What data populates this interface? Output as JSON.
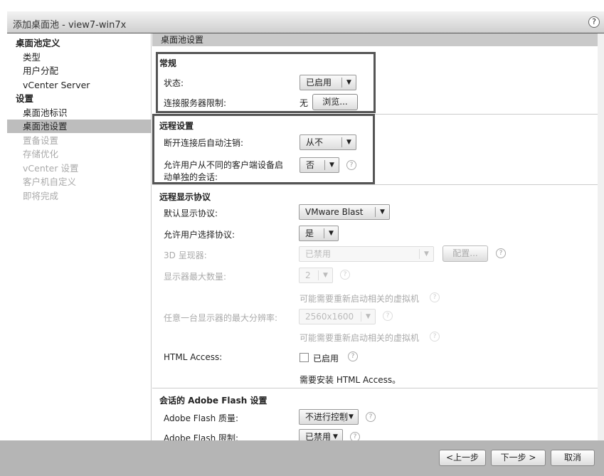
{
  "window": {
    "title": "添加桌面池 - view7-win7x",
    "help": "?"
  },
  "sidebar": {
    "items": [
      {
        "label": "桌面池定义",
        "kind": "h"
      },
      {
        "label": "类型",
        "kind": "i"
      },
      {
        "label": "用户分配",
        "kind": "i"
      },
      {
        "label": "vCenter Server",
        "kind": "i"
      },
      {
        "label": "设置",
        "kind": "h"
      },
      {
        "label": "桌面池标识",
        "kind": "i"
      },
      {
        "label": "桌面池设置",
        "kind": "i sel"
      },
      {
        "label": "置备设置",
        "kind": "i dis"
      },
      {
        "label": "存储优化",
        "kind": "i dis"
      },
      {
        "label": "vCenter 设置",
        "kind": "i dis"
      },
      {
        "label": "客户机自定义",
        "kind": "i dis"
      },
      {
        "label": "即将完成",
        "kind": "i dis"
      }
    ]
  },
  "main": {
    "header": "桌面池设置",
    "general": {
      "title": "常规",
      "state_label": "状态:",
      "state_value": "已启用",
      "conn_label": "连接服务器限制:",
      "conn_value": "无",
      "browse": "浏览..."
    },
    "remote": {
      "title": "远程设置",
      "logoff_label": "断开连接后自动注销:",
      "logoff_value": "从不",
      "separate_label1": "允许用户从不同的客户端设备启",
      "separate_label2": "动单独的会话:",
      "separate_value": "否"
    },
    "display": {
      "title": "远程显示协议",
      "default_label": "默认显示协议:",
      "default_value": "VMware Blast",
      "choose_label": "允许用户选择协议:",
      "choose_value": "是",
      "r3d_label": "3D 呈现器:",
      "r3d_value": "已禁用",
      "configure": "配置...",
      "monitors_label": "显示器最大数量:",
      "monitors_value": "2",
      "restart_note1": "可能需要重新启动相关的虚拟机",
      "res_label": "任意一台显示器的最大分辨率:",
      "res_value": "2560x1600",
      "restart_note2": "可能需要重新启动相关的虚拟机",
      "html_label": "HTML Access:",
      "html_value": "已启用",
      "html_checked": false,
      "html_note": "需要安装 HTML Access。"
    },
    "flash": {
      "title": "会话的 Adobe Flash 设置",
      "quality_label": "Adobe Flash 质量:",
      "quality_value": "不进行控制",
      "throttle_label": "Adobe Flash 限制:",
      "throttle_value": "已禁用"
    }
  },
  "footer": {
    "back": "<上一步",
    "next": "下一步 >",
    "cancel": "取消"
  }
}
